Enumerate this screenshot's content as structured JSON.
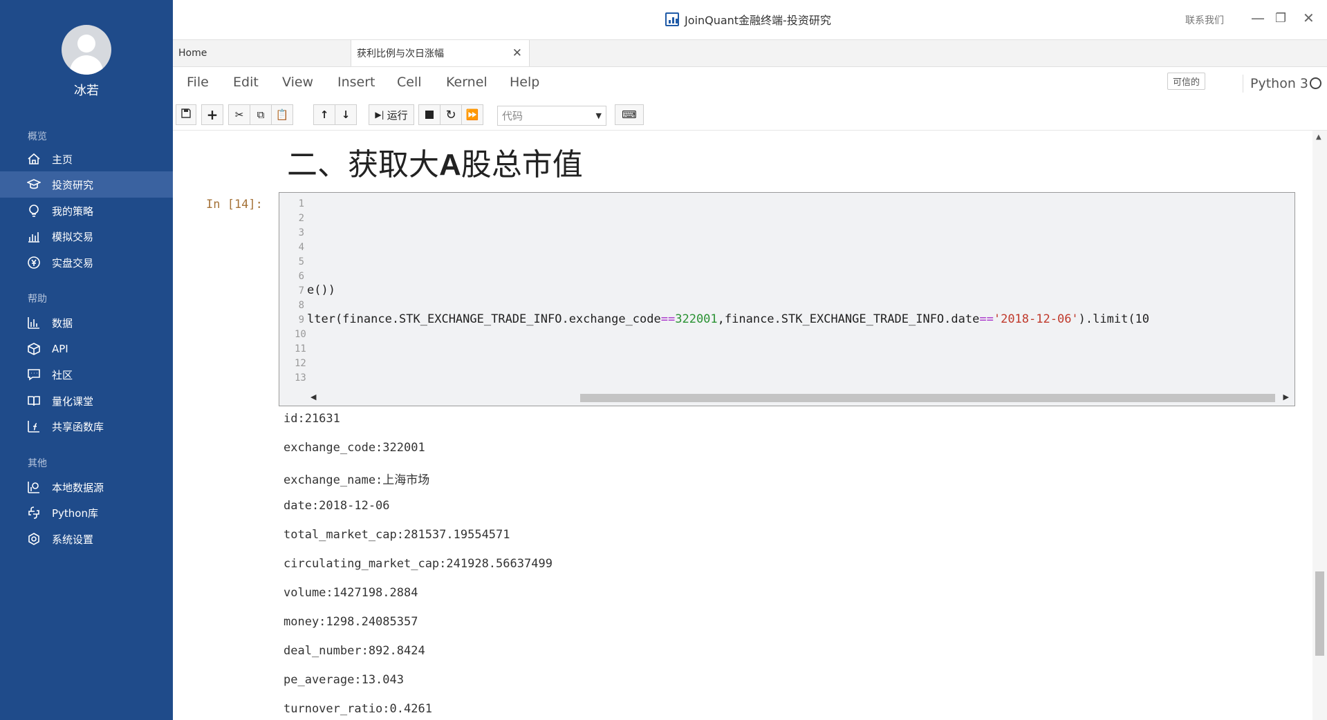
{
  "window": {
    "title": "JoinQuant金融终端-投资研究",
    "contact": "联系我们",
    "controls": {
      "minimize": "—",
      "maximize": "❐",
      "close": "✕"
    }
  },
  "sidebar": {
    "username": "冰若",
    "sections": {
      "overview": "概览",
      "help": "帮助",
      "other": "其他"
    },
    "items": [
      {
        "label": "主页",
        "icon": "home-icon"
      },
      {
        "label": "投资研究",
        "icon": "graduation-cap-icon",
        "active": true
      },
      {
        "label": "我的策略",
        "icon": "lightbulb-icon"
      },
      {
        "label": "模拟交易",
        "icon": "bar-chart-icon"
      },
      {
        "label": "实盘交易",
        "icon": "yen-coin-icon"
      },
      {
        "label": "数据",
        "icon": "column-chart-icon"
      },
      {
        "label": "API",
        "icon": "cube-icon"
      },
      {
        "label": "社区",
        "icon": "chat-icon"
      },
      {
        "label": "量化课堂",
        "icon": "book-icon"
      },
      {
        "label": "共享函数库",
        "icon": "function-icon"
      },
      {
        "label": "本地数据源",
        "icon": "database-chart-icon"
      },
      {
        "label": "Python库",
        "icon": "python-icon"
      },
      {
        "label": "系统设置",
        "icon": "settings-icon"
      }
    ]
  },
  "tabs": [
    {
      "label": "Home"
    },
    {
      "label": "获利比例与次日涨幅",
      "close": "✕"
    }
  ],
  "menu": [
    "File",
    "Edit",
    "View",
    "Insert",
    "Cell",
    "Kernel",
    "Help"
  ],
  "notebook_status": {
    "trusted": "可信的",
    "kernel": "Python 3"
  },
  "toolbar": {
    "run_label": "运行",
    "cell_type": "代码"
  },
  "notebook": {
    "heading_prefix": "二、获取大",
    "heading_bold": "A",
    "heading_suffix": "股总市值",
    "prompt": "In [14]:",
    "line_numbers": [
      "1",
      "2",
      "3",
      "4",
      "5",
      "6",
      "7",
      "8",
      "9",
      "10",
      "11",
      "12",
      "13"
    ],
    "code_line7": "e())",
    "code_line9": {
      "p1": "lter(finance.STK_EXCHANGE_TRADE_INFO.exchange_code",
      "op1": "==",
      "n1": "322001",
      "p2": ",finance.STK_EXCHANGE_TRADE_INFO.date",
      "op2": "==",
      "s1": "'2018-12-06'",
      "p3": ").limit(10"
    },
    "outputs": [
      "id:21631",
      "exchange_code:322001",
      "exchange_name:上海市场",
      "date:2018-12-06",
      "total_market_cap:281537.19554571",
      "circulating_market_cap:241928.56637499",
      "volume:1427198.2884",
      "money:1298.24085357",
      "deal_number:892.8424",
      "pe_average:13.043",
      "turnover_ratio:0.4261"
    ]
  }
}
